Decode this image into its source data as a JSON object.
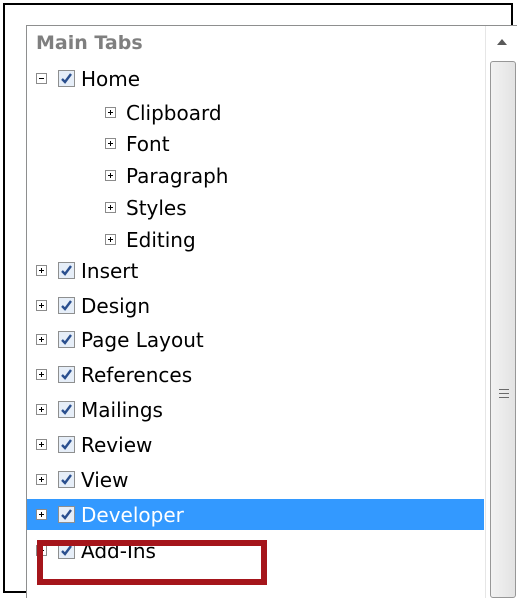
{
  "header": "Main Tabs",
  "tree": [
    {
      "label": "Home",
      "level": 0,
      "expander": "minus",
      "checked": true,
      "selected": false
    },
    {
      "label": "Clipboard",
      "level": 1,
      "expander": "plus",
      "checked": null,
      "selected": false
    },
    {
      "label": "Font",
      "level": 1,
      "expander": "plus",
      "checked": null,
      "selected": false
    },
    {
      "label": "Paragraph",
      "level": 1,
      "expander": "plus",
      "checked": null,
      "selected": false
    },
    {
      "label": "Styles",
      "level": 1,
      "expander": "plus",
      "checked": null,
      "selected": false
    },
    {
      "label": "Editing",
      "level": 1,
      "expander": "plus",
      "checked": null,
      "selected": false
    },
    {
      "label": "Insert",
      "level": 0,
      "expander": "plus",
      "checked": true,
      "selected": false
    },
    {
      "label": "Design",
      "level": 0,
      "expander": "plus",
      "checked": true,
      "selected": false
    },
    {
      "label": "Page Layout",
      "level": 0,
      "expander": "plus",
      "checked": true,
      "selected": false
    },
    {
      "label": "References",
      "level": 0,
      "expander": "plus",
      "checked": true,
      "selected": false
    },
    {
      "label": "Mailings",
      "level": 0,
      "expander": "plus",
      "checked": true,
      "selected": false
    },
    {
      "label": "Review",
      "level": 0,
      "expander": "plus",
      "checked": true,
      "selected": false
    },
    {
      "label": "View",
      "level": 0,
      "expander": "plus",
      "checked": true,
      "selected": false
    },
    {
      "label": "Developer",
      "level": 0,
      "expander": "plus",
      "checked": true,
      "selected": true
    },
    {
      "label": "Add-Ins",
      "level": 0,
      "expander": "plus",
      "checked": true,
      "selected": false
    }
  ],
  "icons": {
    "scroll_up": "chevron-up-icon",
    "grip": "scrollbar-grip-icon",
    "expand": "plus-box-icon",
    "collapse": "minus-box-icon",
    "check": "checkmark-icon"
  },
  "colors": {
    "selection": "#3399ff",
    "highlight_border": "#a5151b",
    "check": "#2a4f8e",
    "header_text": "#7f7f7f"
  }
}
